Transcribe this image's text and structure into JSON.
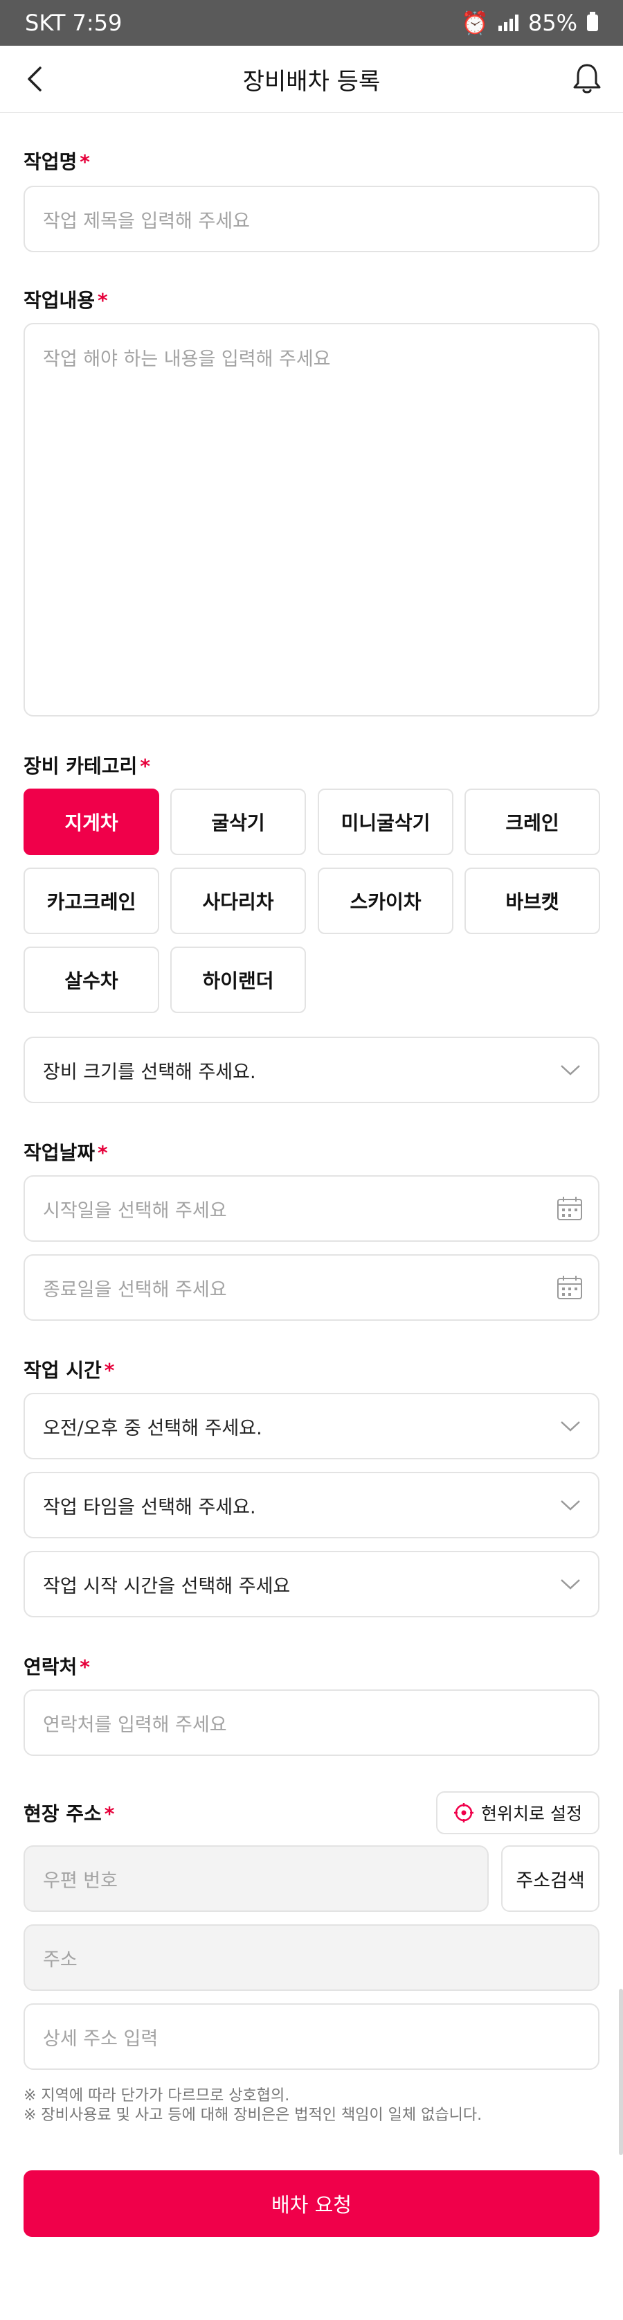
{
  "status_bar": {
    "carrier_time": "SKT 7:59",
    "battery": "85%"
  },
  "header": {
    "title": "장비배차 등록"
  },
  "required_mark": "*",
  "work_name": {
    "label": "작업명",
    "placeholder": "작업 제목을 입력해 주세요"
  },
  "work_content": {
    "label": "작업내용",
    "placeholder": "작업 해야 하는 내용을 입력해 주세요"
  },
  "equipment": {
    "label": "장비 카테고리",
    "categories": [
      "지게차",
      "굴삭기",
      "미니굴삭기",
      "크레인",
      "카고크레인",
      "사다리차",
      "스카이차",
      "바브캣",
      "살수차",
      "하이랜더"
    ],
    "selected": "지게차",
    "size_placeholder": "장비 크기를 선택해 주세요."
  },
  "work_date": {
    "label": "작업날짜",
    "start_placeholder": "시작일을 선택해 주세요",
    "end_placeholder": "종료일을 선택해 주세요"
  },
  "work_time": {
    "label": "작업 시간",
    "ampm_placeholder": "오전/오후 중 선택해 주세요.",
    "type_placeholder": "작업 타임을 선택해 주세요.",
    "start_placeholder": "작업 시작 시간을 선택해 주세요"
  },
  "contact": {
    "label": "연락처",
    "placeholder": "연락처를 입력해 주세요"
  },
  "site_address": {
    "label": "현장 주소",
    "current_location_button": "현위치로 설정",
    "postal_placeholder": "우편 번호",
    "search_button": "주소검색",
    "address_placeholder": "주소",
    "detail_placeholder": "상세 주소 입력"
  },
  "notes": [
    "※ 지역에 따라 단가가 다르므로 상호협의.",
    "※ 장비사용료 및 사고 등에 대해 장비은은 법적인 책임이 일체 없습니다."
  ],
  "submit_button": "배차 요청",
  "colors": {
    "accent": "#f0004a",
    "status_bar": "#5a5a5a",
    "border": "#e3e3e3"
  }
}
